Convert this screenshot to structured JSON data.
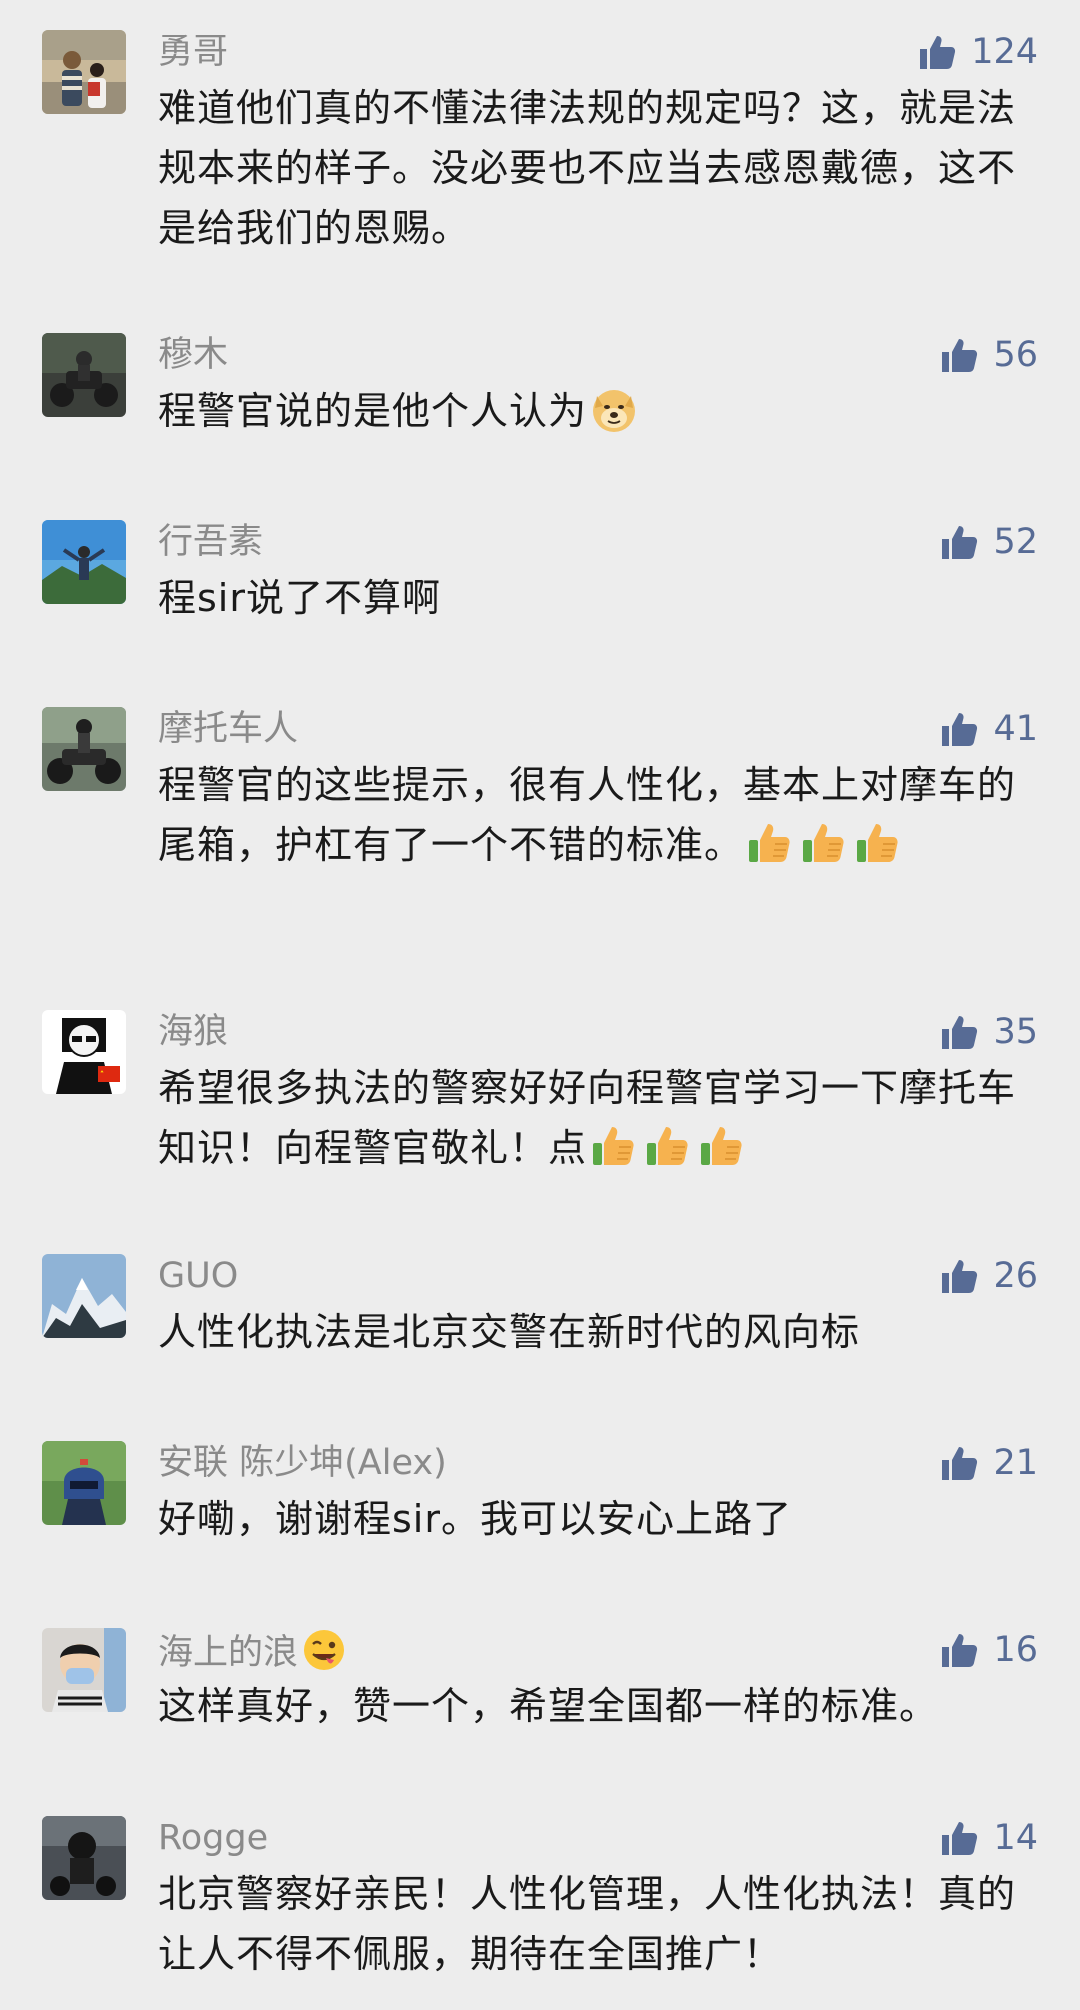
{
  "colors": {
    "background": "#ededed",
    "nickname": "#8a8a8a",
    "like_accent": "#576b95",
    "text": "#1a1a1a"
  },
  "comments": [
    {
      "nickname": "勇哥",
      "likes": "124",
      "text": "难道他们真的不懂法律法规的规定吗？这，就是法规本来的样子。没必要也不应当去感恩戴德，这不是给我们的恩赐。",
      "avatar": "photo-two-people-avatar"
    },
    {
      "nickname": "穆木",
      "likes": "56",
      "text": "程警官说的是他个人认为",
      "trailing_emoji": "doge-icon",
      "avatar": "motorcycle-photo-avatar"
    },
    {
      "nickname": "行吾素",
      "likes": "52",
      "text": "程sir说了不算啊",
      "avatar": "person-on-mountain-avatar"
    },
    {
      "nickname": "摩托车人",
      "likes": "41",
      "text": "程警官的这些提示，很有人性化，基本上对摩车的尾箱，护杠有了一个不错的标准。",
      "trailing_emoji": "thumbs-up-icon",
      "trailing_emoji_count": 3,
      "avatar": "rider-on-motorcycle-avatar"
    },
    {
      "nickname": "海狼",
      "likes": "35",
      "text": "希望很多执法的警察好好向程警官学习一下摩托车知识！向程警官敬礼！点",
      "trailing_emoji": "thumbs-up-icon",
      "trailing_emoji_count": 3,
      "avatar": "cartoon-man-flag-avatar"
    },
    {
      "nickname": "GUO",
      "likes": "26",
      "text": "人性化执法是北京交警在新时代的风向标",
      "avatar": "snowy-mountain-avatar"
    },
    {
      "nickname": "安联 陈少坤(Alex)",
      "likes": "21",
      "text": "好嘞，谢谢程sir。我可以安心上路了",
      "avatar": "helmet-figure-avatar"
    },
    {
      "nickname": "海上的浪",
      "nickname_emoji": "tongue-wink-icon",
      "likes": "16",
      "text": "这样真好，赞一个，希望全国都一样的标准。",
      "avatar": "masked-person-avatar"
    },
    {
      "nickname": "Rogge",
      "likes": "14",
      "text": "北京警察好亲民！人性化管理，人性化执法！真的让人不得不佩服，期待在全国推广！",
      "avatar": "rider-dark-avatar"
    }
  ]
}
